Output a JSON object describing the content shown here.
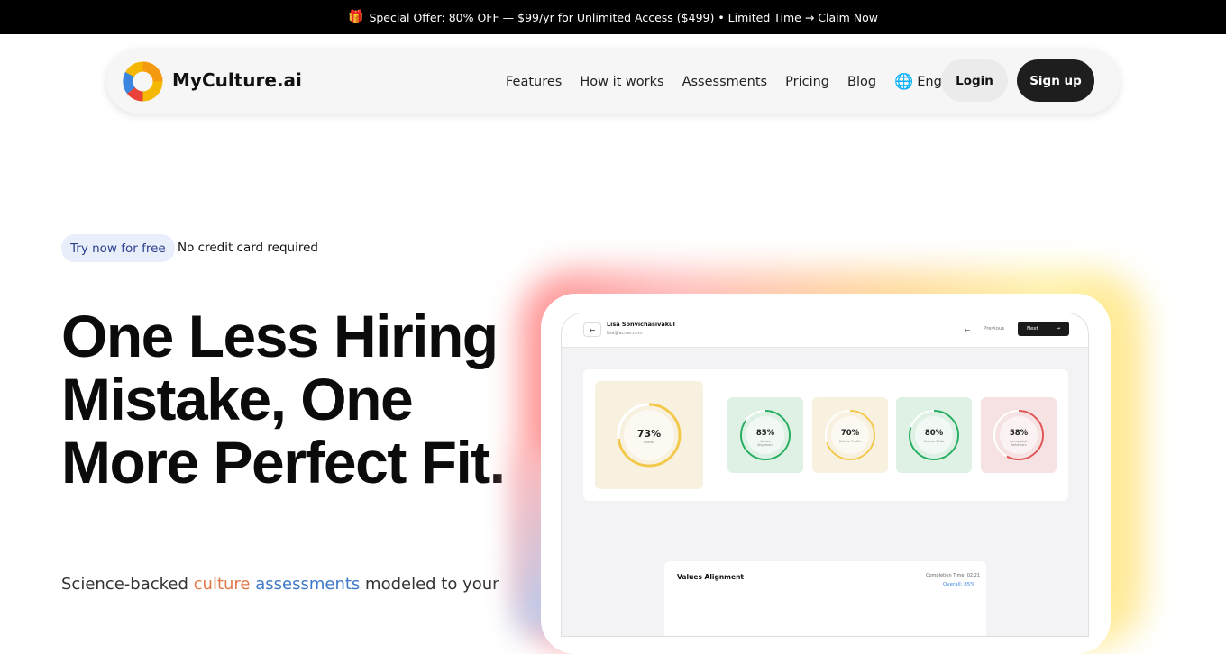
{
  "promo": {
    "icon": "gift-icon",
    "text": "Special Offer: 80% OFF — $99/yr for Unlimited Access ($499) • Limited Time → Claim Now"
  },
  "nav": {
    "brand": "MyCulture.ai",
    "items": [
      "Features",
      "How it works",
      "Assessments",
      "Pricing",
      "Blog"
    ],
    "language": "Eng",
    "login": "Login",
    "signup": "Sign up"
  },
  "hero": {
    "badge": "Try now for free",
    "badge_note": "No credit card required",
    "headline": "One Less Hiring Mistake, One More Perfect Fit.",
    "sub_prefix": "Science-backed ",
    "sub_hl1": "culture",
    "sub_hl2": "assessments",
    "sub_suffix": " modeled to your"
  },
  "dashboard": {
    "user_name": "Lisa Sonvichasivakul",
    "user_email": "lisa@acme.com",
    "prev_label": "Previous",
    "next_label": "Next",
    "scores": [
      {
        "pct": "73%",
        "label": "Overall",
        "value": 0.73,
        "color": "#f2c94c",
        "bg": "#f8f1e0"
      },
      {
        "pct": "85%",
        "label": "Values Alignment",
        "value": 0.85,
        "color": "#27ae60",
        "bg": "#dff1e5"
      },
      {
        "pct": "70%",
        "label": "Culture Profile",
        "value": 0.7,
        "color": "#f2c94c",
        "bg": "#f8f1e0"
      },
      {
        "pct": "80%",
        "label": "Human Skills",
        "value": 0.8,
        "color": "#27ae60",
        "bg": "#dff1e5"
      },
      {
        "pct": "58%",
        "label": "Acceptable Behaviors",
        "value": 0.58,
        "color": "#e05555",
        "bg": "#f6e2e2"
      }
    ],
    "values_title": "Values Alignment",
    "completion_time": "Completion Time: 02:21",
    "overall_text": "Overall:  85%"
  }
}
